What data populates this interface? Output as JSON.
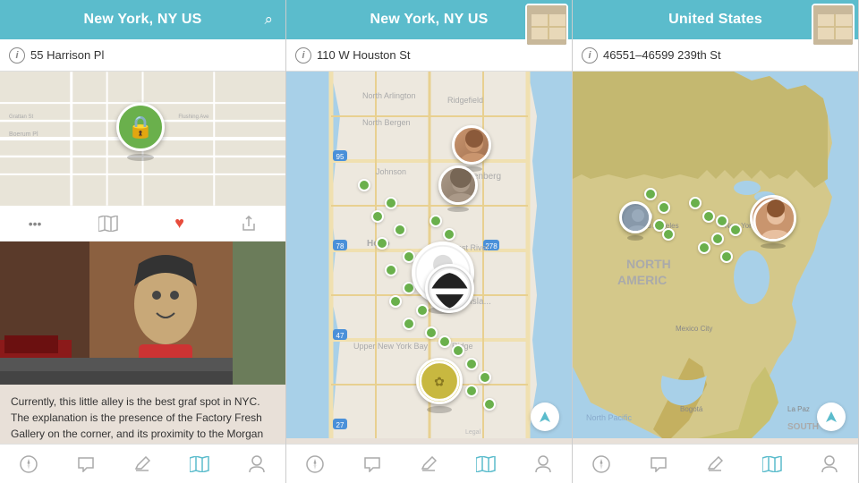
{
  "panels": [
    {
      "id": "panel-1",
      "header": {
        "title": "New York, NY US",
        "search_label": "search"
      },
      "address": "55 Harrison Pl",
      "map_zoom": "street",
      "action_bar": {
        "more_label": "•••",
        "map_label": "map",
        "like_label": "♥",
        "share_label": "share"
      },
      "post": {
        "caption": "Currently, this little alley is the best graf spot in NYC. The explanation is the presence of the Factory Fresh Gallery on the corner, and its proximity to the Morgan Street stop on the L."
      }
    },
    {
      "id": "panel-2",
      "header": {
        "title": "New York, NY US",
        "search_label": "search"
      },
      "address": "110 W Houston St",
      "map_zoom": "city",
      "has_thumbnail": true
    },
    {
      "id": "panel-3",
      "header": {
        "title": "United States",
        "search_label": "search"
      },
      "address": "46551–46599 239th St",
      "map_zoom": "country",
      "has_thumbnail": true
    }
  ],
  "toolbar": {
    "icons": [
      {
        "name": "compass",
        "symbol": "⊕",
        "active": false
      },
      {
        "name": "chat",
        "symbol": "💬",
        "active": false
      },
      {
        "name": "edit",
        "symbol": "✏",
        "active": false
      },
      {
        "name": "map",
        "symbol": "🗺",
        "active": true
      },
      {
        "name": "profile",
        "symbol": "👤",
        "active": false
      }
    ]
  },
  "colors": {
    "header_bg": "#5bbccc",
    "accent": "#6ab04c",
    "heart": "#e74c3c",
    "text_dark": "#333333",
    "text_light": "#888888"
  }
}
